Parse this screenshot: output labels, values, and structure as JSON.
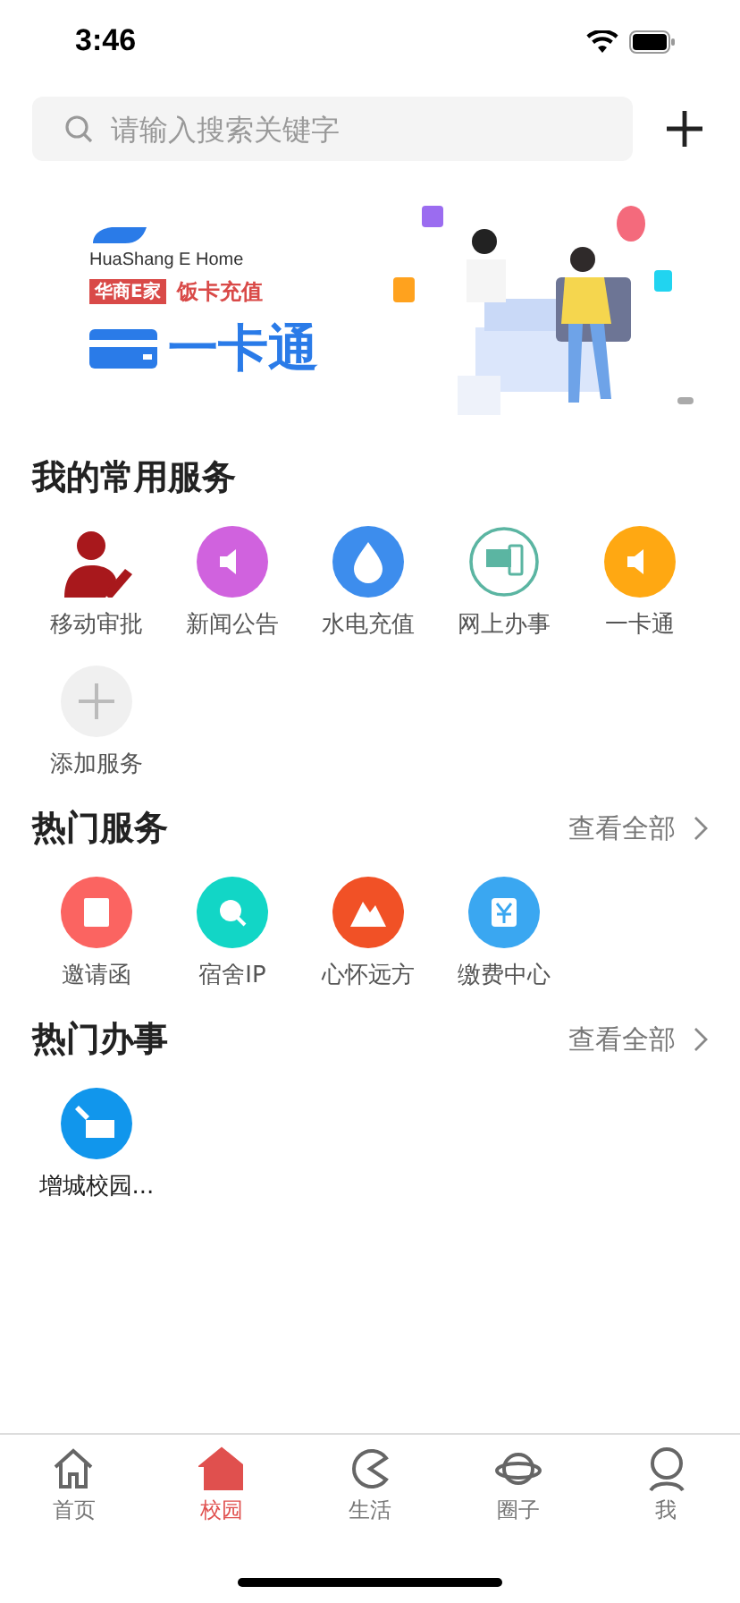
{
  "status_bar": {
    "time": "3:46"
  },
  "search": {
    "placeholder": "请输入搜索关键字"
  },
  "banner": {
    "brand": "HuaShang E Home",
    "tag": "华商E家",
    "slogan": "饭卡充值",
    "headline": "一卡通"
  },
  "my_services": {
    "title": "我的常用服务",
    "items": [
      {
        "label": "移动审批",
        "kind": "figure",
        "color": "#a8181c"
      },
      {
        "label": "新闻公告",
        "kind": "circle",
        "color": "#d062de"
      },
      {
        "label": "水电充值",
        "kind": "circle",
        "color": "#3d8ded"
      },
      {
        "label": "网上办事",
        "kind": "outline",
        "color": "#5bb5a2"
      },
      {
        "label": "一卡通",
        "kind": "circle",
        "color": "#ffa812"
      },
      {
        "label": "添加服务",
        "kind": "add",
        "color": "#f0f0f0"
      }
    ]
  },
  "hot_services": {
    "title": "热门服务",
    "more": "查看全部",
    "items": [
      {
        "label": "邀请函",
        "color": "#fb6461"
      },
      {
        "label": "宿舍IP",
        "color": "#12d6c6"
      },
      {
        "label": "心怀远方",
        "color": "#f15126"
      },
      {
        "label": "缴费中心",
        "color": "#3aa7f1"
      }
    ]
  },
  "hot_affairs": {
    "title": "热门办事",
    "more": "查看全部",
    "items": [
      {
        "label": "增城校园...",
        "color": "#1196ec"
      }
    ]
  },
  "tab_bar": [
    {
      "label": "首页",
      "selected": false
    },
    {
      "label": "校园",
      "selected": true
    },
    {
      "label": "生活",
      "selected": false
    },
    {
      "label": "圈子",
      "selected": false
    },
    {
      "label": "我",
      "selected": false
    }
  ]
}
